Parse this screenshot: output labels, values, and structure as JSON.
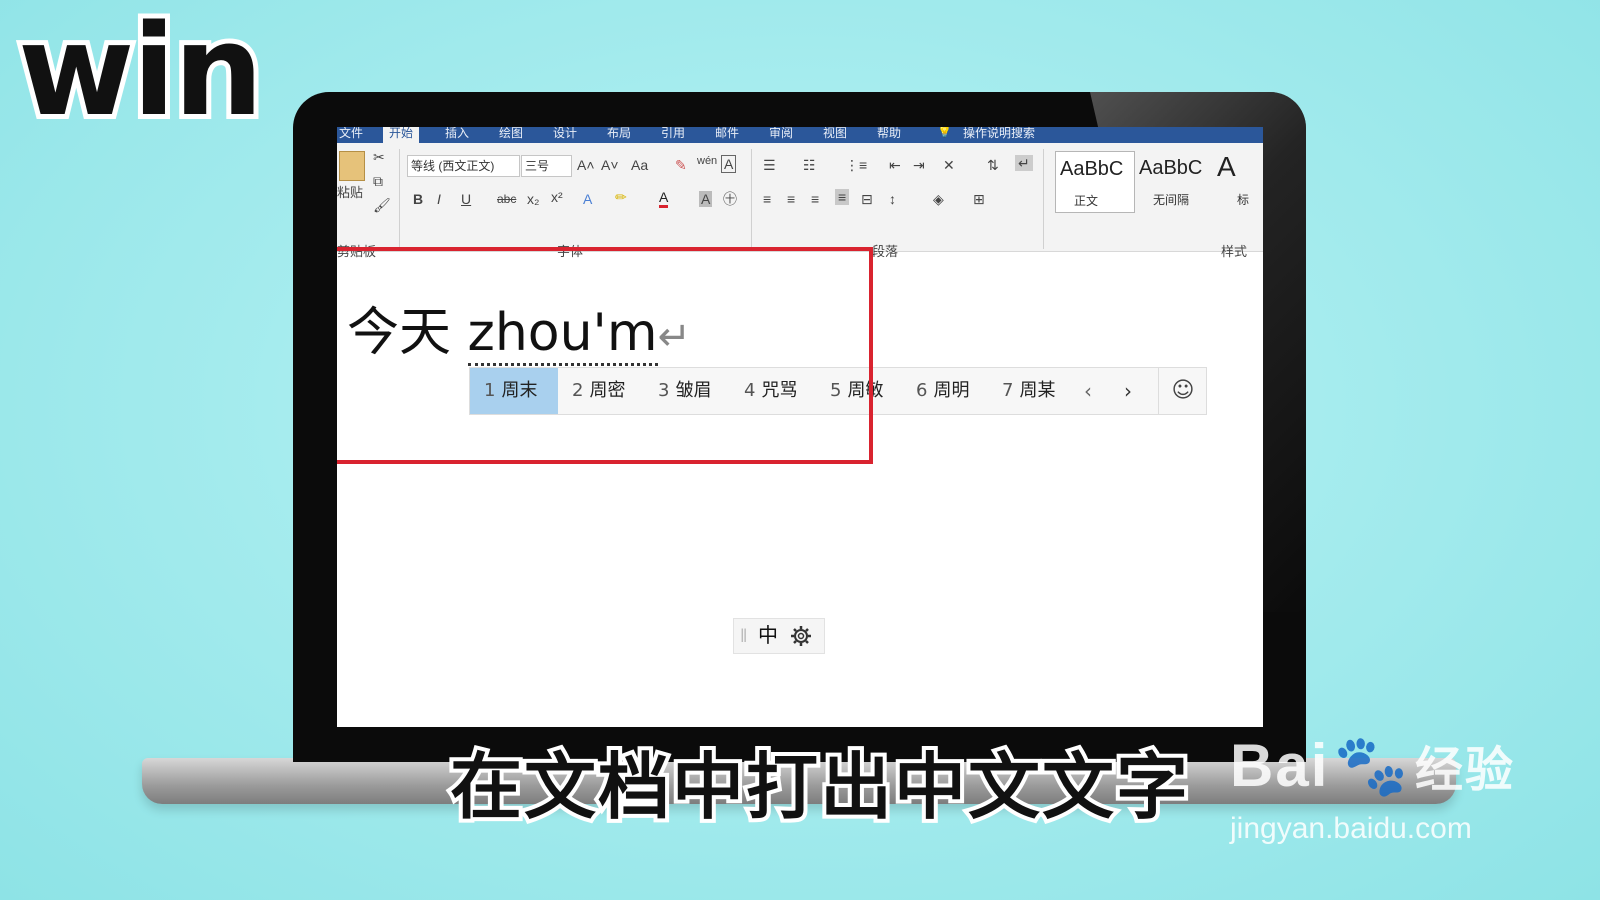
{
  "overlay": {
    "corner_label": "win",
    "subtitle": "在文档中打出中文文字",
    "watermark_brand": "Bai",
    "watermark_suffix": "经验",
    "watermark_url": "jingyan.baidu.com"
  },
  "ribbon": {
    "tabs": [
      "文件",
      "开始",
      "插入",
      "绘图",
      "设计",
      "布局",
      "引用",
      "邮件",
      "审阅",
      "视图",
      "帮助",
      "操作说明搜索"
    ],
    "active_tab": "开始",
    "clipboard": {
      "paste_label": "粘贴",
      "group_label": "剪贴板"
    },
    "font": {
      "family_value": "等线 (西文正文)",
      "size_value": "三号",
      "group_label": "字体",
      "bold": "B",
      "italic": "I",
      "underline": "U",
      "strike": "abc",
      "subscript": "x₂",
      "superscript": "x²",
      "grow": "A˄",
      "shrink": "A˅",
      "case": "Aa",
      "font_color": "A",
      "char_shading": "A",
      "wen": "wén"
    },
    "paragraph": {
      "group_label": "段落"
    },
    "styles": {
      "group_label": "样式",
      "items": [
        {
          "sample": "AaBbC",
          "name": "正文"
        },
        {
          "sample": "AaBbC",
          "name": "无间隔"
        },
        {
          "sample": "A",
          "name": "标"
        }
      ]
    }
  },
  "document": {
    "typed_text": "今天 ",
    "composing_text": "zhou'm",
    "return_mark": "↵"
  },
  "ime": {
    "candidates": [
      {
        "num": "1",
        "text": "周末"
      },
      {
        "num": "2",
        "text": "周密"
      },
      {
        "num": "3",
        "text": "皱眉"
      },
      {
        "num": "4",
        "text": "咒骂"
      },
      {
        "num": "5",
        "text": "周敏"
      },
      {
        "num": "6",
        "text": "周明"
      },
      {
        "num": "7",
        "text": "周某"
      }
    ],
    "selected_index": 0,
    "prev": "‹",
    "next": "›",
    "emoji": "☺",
    "status_mode": "中",
    "settings_icon": "gear-icon"
  },
  "colors": {
    "ribbon_blue": "#2b579a",
    "highlight_red": "#d9232f",
    "candidate_selected": "#a9d0ee",
    "background": "#a6ecee"
  }
}
